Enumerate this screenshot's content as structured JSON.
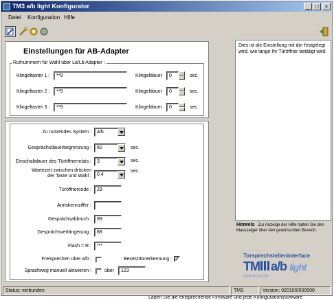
{
  "window": {
    "title": "TM3 a/b light  Konfigurator",
    "controls": {
      "minimize": "_",
      "maximize": "□",
      "close": "×"
    }
  },
  "menu": {
    "items": [
      "Datei",
      "Konfiguration",
      "Hilfe"
    ]
  },
  "toolbar": {
    "icons": [
      "config-icon",
      "wrench-icon",
      "gear-icon",
      "gear-alt-icon",
      "exit-icon"
    ]
  },
  "form": {
    "heading": "Einstellungen für AB-Adapter",
    "rufnummern": {
      "group_title": "Rufnummern für Wahl über La/Lb Adapter :",
      "rows": [
        {
          "label": "Klingeltaster 1 :",
          "value": "**9",
          "dauer_label": "Klingeldauer",
          "dauer": "0",
          "unit": "sec."
        },
        {
          "label": "Klingeltaster 2 :",
          "value": "**9",
          "dauer_label": "Klingeldauer",
          "dauer": "0",
          "unit": "sec."
        },
        {
          "label": "Klingeltaster 3 :",
          "value": "**9",
          "dauer_label": "Klingeldauer",
          "dauer": "0",
          "unit": "sec."
        }
      ]
    },
    "system": {
      "label": "Zu nutzendes System :",
      "value": "a/b",
      "gespraech_label": "Gesprächsdauerbegrenzung :",
      "gespraech": "60",
      "gespraech_unit": "sec.",
      "einschalt_label": "Einschaltdauer des Türöffnerrelais :",
      "einschalt": "3",
      "einschalt_unit": "sec.",
      "wartezeit_label1": "Wartezeit zwischen drücken",
      "wartezeit_label2": "der Taste und Wahl :",
      "wartezeit": "0,4",
      "wartezeit_unit": "sec.",
      "tuercode_label": "Türöffnercode :",
      "tuercode": "29",
      "amt_label": "Amtskennziffer :",
      "amt": "",
      "abbruch_label": "Gesprächsabbruch :",
      "abbruch": "99",
      "verlaengerung_label": "Gesprächsverlängerung :",
      "verlaengerung": "88",
      "flash_label": "Flash = R :",
      "flash": "***",
      "frei_label": "Freisprechen über a/b :",
      "frei_checked": false,
      "besetzt_label": "Besetzttonerkennung :",
      "besetzt_checked": true,
      "sprachweg_label": "Sprachweg manuell aktivieren :",
      "sprachweg_checked": false,
      "ueber_label": "über",
      "ueber": "123"
    }
  },
  "help": {
    "text": "Dies ist die Einstellung mit der festgelegt wird, wie lange Ihr Türöffner betätigt wird.",
    "hint_title": "Hinweis",
    "hint_text": "Zur Anzeige der Hilfe halten Sie den Mauszeiger über den gewünschten Bereich."
  },
  "logo": {
    "line1": "Torsprechstelleninterface",
    "brand": "TM",
    "product": "a/b",
    "light": "light",
    "domain": "homeros.de"
  },
  "status": {
    "left": "Status: verbunden",
    "device": "TM3",
    "version": "Version: 020100/030000"
  },
  "background": {
    "bottom_text": "Laden Sie die entsprechende Firmware und jede Konfigurationssoftware"
  },
  "colors": {
    "titlebar_start": "#0a246a",
    "titlebar_end": "#a6caf0",
    "face": "#d4d0c8",
    "logo_blue": "#2b4fa0"
  }
}
